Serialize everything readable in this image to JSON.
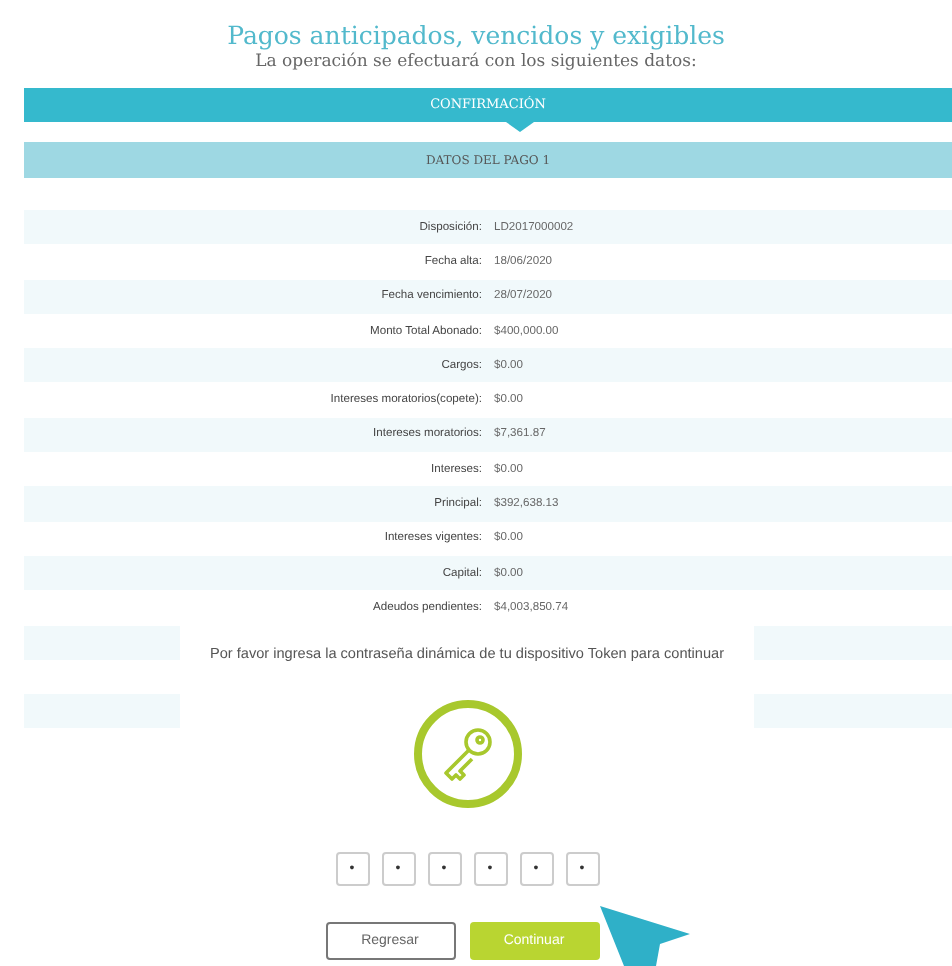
{
  "header": {
    "title": "Pagos anticipados, vencidos y exigibles",
    "subtitle": "La operación se efectuará con los siguientes datos:"
  },
  "step_bar": {
    "label": "CONFIRMACIÓN"
  },
  "section_bar": {
    "label": "DATOS DEL PAGO 1"
  },
  "details": [
    {
      "label": "Disposición:",
      "value": "LD2017000002"
    },
    {
      "label": "Fecha alta:",
      "value": "18/06/2020"
    },
    {
      "label": "Fecha vencimiento:",
      "value": "28/07/2020"
    },
    {
      "label": "Monto Total Abonado:",
      "value": "$400,000.00"
    },
    {
      "label": "Cargos:",
      "value": "$0.00"
    },
    {
      "label": "Intereses moratorios(copete):",
      "value": "$0.00"
    },
    {
      "label": "Intereses moratorios:",
      "value": "$7,361.87"
    },
    {
      "label": "Intereses:",
      "value": "$0.00"
    },
    {
      "label": "Principal:",
      "value": "$392,638.13"
    },
    {
      "label": "Intereses vigentes:",
      "value": "$0.00"
    },
    {
      "label": "Capital:",
      "value": "$0.00"
    },
    {
      "label": "Adeudos pendientes:",
      "value": "$4,003,850.74"
    }
  ],
  "token_dialog": {
    "message": "Por favor ingresa la contraseña dinámica de tu dispositivo Token para continuar",
    "digits": [
      {
        "value": "•"
      },
      {
        "value": "•"
      },
      {
        "value": "•"
      },
      {
        "value": "•"
      },
      {
        "value": "•"
      },
      {
        "value": "•"
      }
    ],
    "buttons": [
      {
        "label": "Regresar",
        "kind": "secondary"
      },
      {
        "label": "Continuar",
        "kind": "primary"
      }
    ]
  }
}
